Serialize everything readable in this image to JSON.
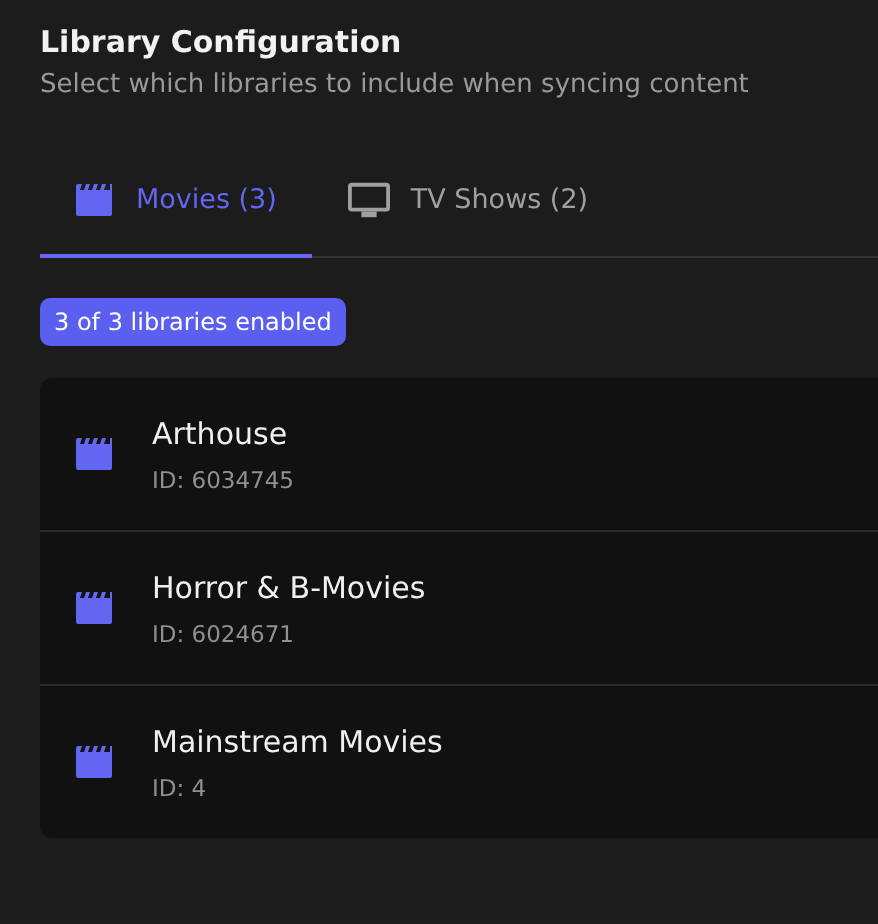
{
  "header": {
    "title": "Library Configuration",
    "subtitle": "Select which libraries to include when syncing content"
  },
  "tabs": [
    {
      "label": "Movies (3)",
      "kind": "movie",
      "selected": true
    },
    {
      "label": "TV Shows (2)",
      "kind": "tv",
      "selected": false
    }
  ],
  "badge": "3 of 3 libraries enabled",
  "libraries": [
    {
      "name": "Arthouse",
      "id": "ID: 6034745"
    },
    {
      "name": "Horror & B-Movies",
      "id": "ID: 6024671"
    },
    {
      "name": "Mainstream Movies",
      "id": "ID: 4"
    }
  ]
}
